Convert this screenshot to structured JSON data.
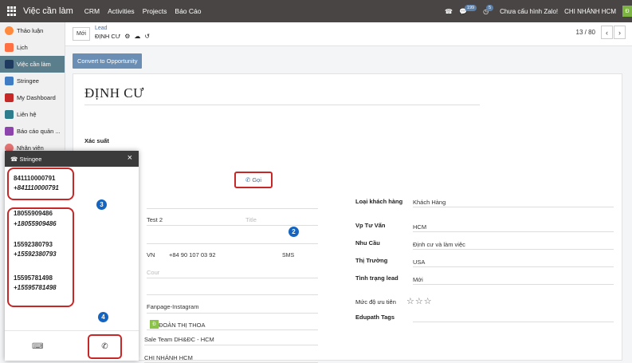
{
  "topbar": {
    "app_title": "Việc cần làm",
    "menu": [
      "CRM",
      "Activities",
      "Projects",
      "Báo Cáo"
    ],
    "msg_count": "199",
    "activity_count": "5",
    "zalo_status": "Chưa cấu hình Zalo!",
    "branch": "CHI NHÁNH HCM",
    "avatar_letter": "Đ"
  },
  "sidebar": {
    "items": [
      {
        "label": "Thảo luận",
        "icon": "chat-icon",
        "color": "#ff8a3d"
      },
      {
        "label": "Lịch",
        "icon": "calendar-icon",
        "color": "#ff7043"
      },
      {
        "label": "Việc cần làm",
        "icon": "pencil-icon",
        "color": "#1e3a5f"
      },
      {
        "label": "Stringee",
        "icon": "cloud-icon",
        "color": "#3f7cc4"
      },
      {
        "label": "My Dashboard",
        "icon": "dashboard-icon",
        "color": "#c62828"
      },
      {
        "label": "Liên hệ",
        "icon": "contact-icon",
        "color": "#2e7d8c"
      },
      {
        "label": "Báo cáo quản ...",
        "icon": "report-icon",
        "color": "#8e44ad"
      },
      {
        "label": "Nhân viên",
        "icon": "people-icon",
        "color": "#e57373"
      }
    ]
  },
  "breadcrumb": {
    "new_label": "Mới",
    "parent": "Lead",
    "current": "ĐỊNH CƯ",
    "pager": "13 / 80"
  },
  "actions": {
    "convert": "Convert to Opportunity"
  },
  "form": {
    "lead_name": "ĐỊNH CƯ",
    "probability_label": "Xác suất",
    "contact_name": "Test 2",
    "title_placeholder": "Title",
    "country_code": "VN",
    "phone": "+84 90 107 03 92",
    "call_label": "Gọi",
    "sms_label": "SMS",
    "country_placeholder": "Cour",
    "source": "Fanpage-Instagram",
    "salesperson": "ĐOÀN THỊ THOA",
    "salesperson_avatar": "Đ",
    "sales_team": "Sale Team DH&ĐC - HCM",
    "branch": "CHI NHÁNH HCM",
    "right_fields": [
      {
        "label": "Loại khách hàng",
        "value": "Khách Hàng"
      },
      {
        "label": "Vp Tư Vấn",
        "value": "HCM"
      },
      {
        "label": "Nhu Cầu",
        "value": "Định cư và làm việc"
      },
      {
        "label": "Thị Trường",
        "value": "USA"
      },
      {
        "label": "Tình trạng lead",
        "value": "Mới"
      }
    ],
    "priority_label": "Mức độ ưu tiên",
    "priority_stars": "☆☆☆",
    "edupath_label": "Edupath Tags"
  },
  "stringee": {
    "title": "Stringee",
    "calls": [
      {
        "number": "841110000791",
        "formatted": "+841110000791"
      },
      {
        "number": "18055909486",
        "formatted": "+18055909486"
      },
      {
        "number": "15592380793",
        "formatted": "+15592380793"
      },
      {
        "number": "15595781498",
        "formatted": "+15595781498"
      }
    ]
  },
  "annotations": [
    "2",
    "3",
    "4"
  ]
}
